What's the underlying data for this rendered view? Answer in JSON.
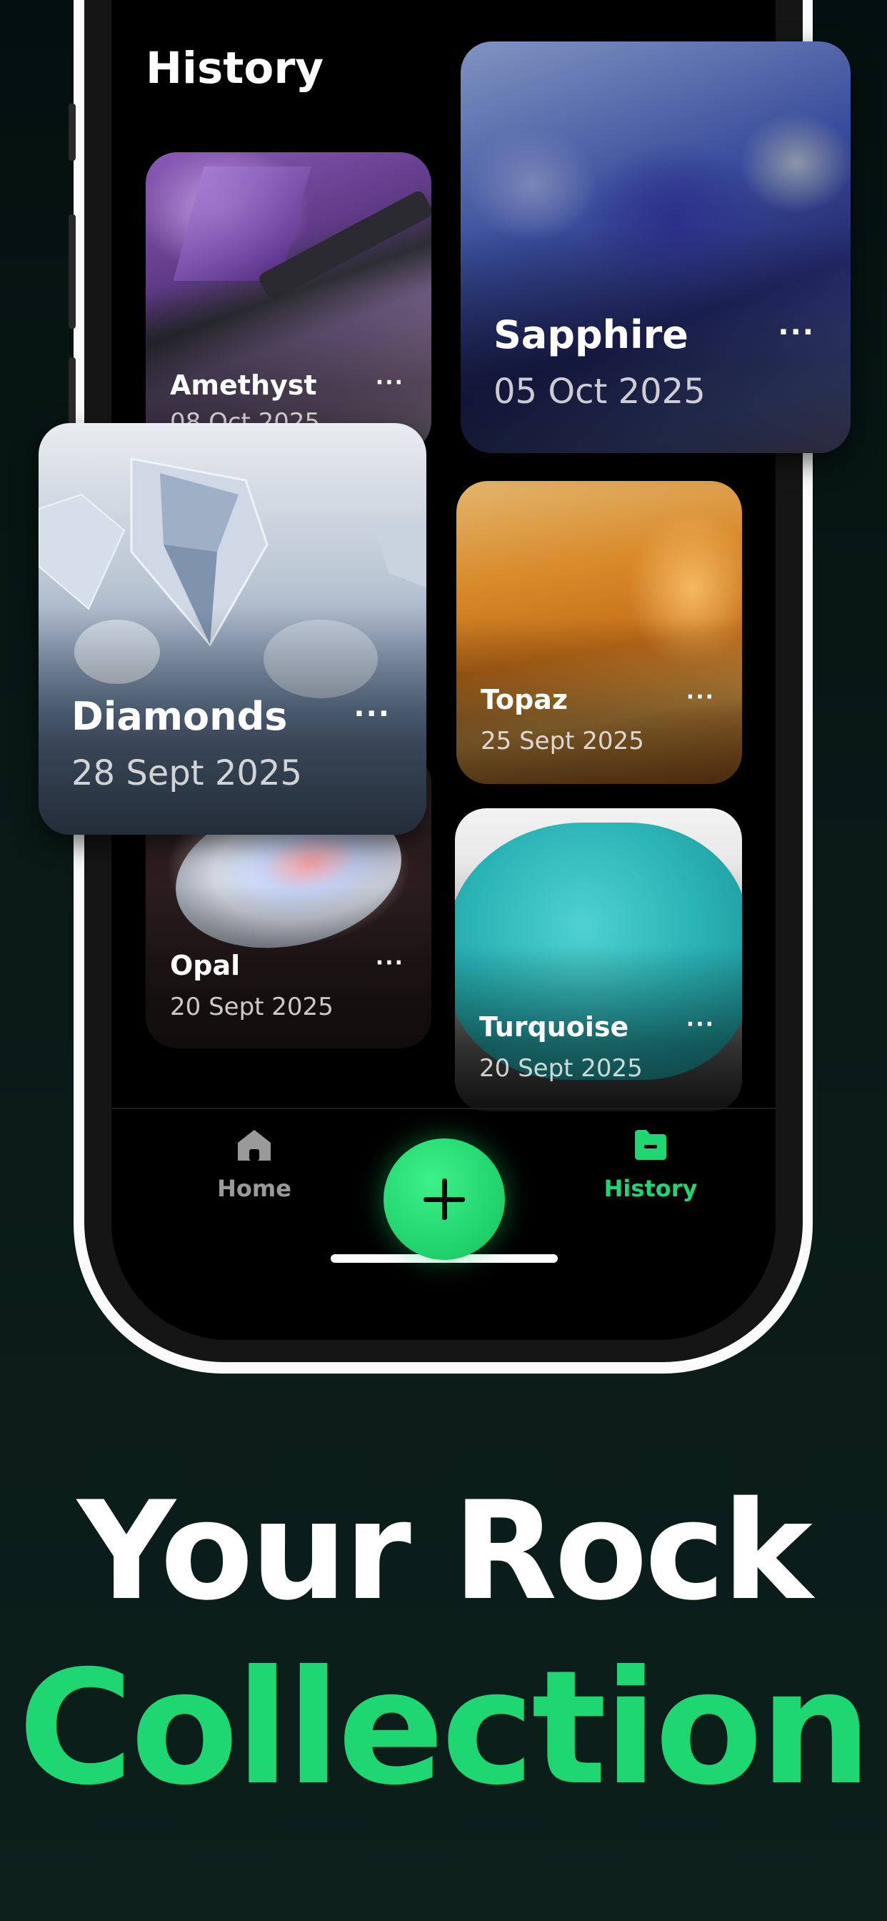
{
  "screen": {
    "title": "History"
  },
  "cards": [
    {
      "id": "amethyst",
      "name": "Amethyst",
      "date": "08 Oct 2025",
      "menu": "···"
    },
    {
      "id": "sapphire",
      "name": "Sapphire",
      "date": "05 Oct 2025",
      "menu": "···"
    },
    {
      "id": "diamonds",
      "name": "Diamonds",
      "date": "28 Sept 2025",
      "menu": "···"
    },
    {
      "id": "topaz",
      "name": "Topaz",
      "date": "25 Sept 2025",
      "menu": "···"
    },
    {
      "id": "opal",
      "name": "Opal",
      "date": "20 Sept 2025",
      "menu": "···"
    },
    {
      "id": "turquoise",
      "name": "Turquoise",
      "date": "20 Sept 2025",
      "menu": "···"
    }
  ],
  "nav": {
    "home_label": "Home",
    "history_label": "History",
    "add_icon": "plus-icon",
    "home_icon": "home-icon",
    "history_icon": "folder-icon",
    "active_color": "#1ed773",
    "inactive_color": "#9a9a9a"
  },
  "headline": {
    "line1": "Your Rock",
    "line2": "Collection"
  },
  "colors": {
    "accent": "#1ed773",
    "background": "#06120f"
  }
}
